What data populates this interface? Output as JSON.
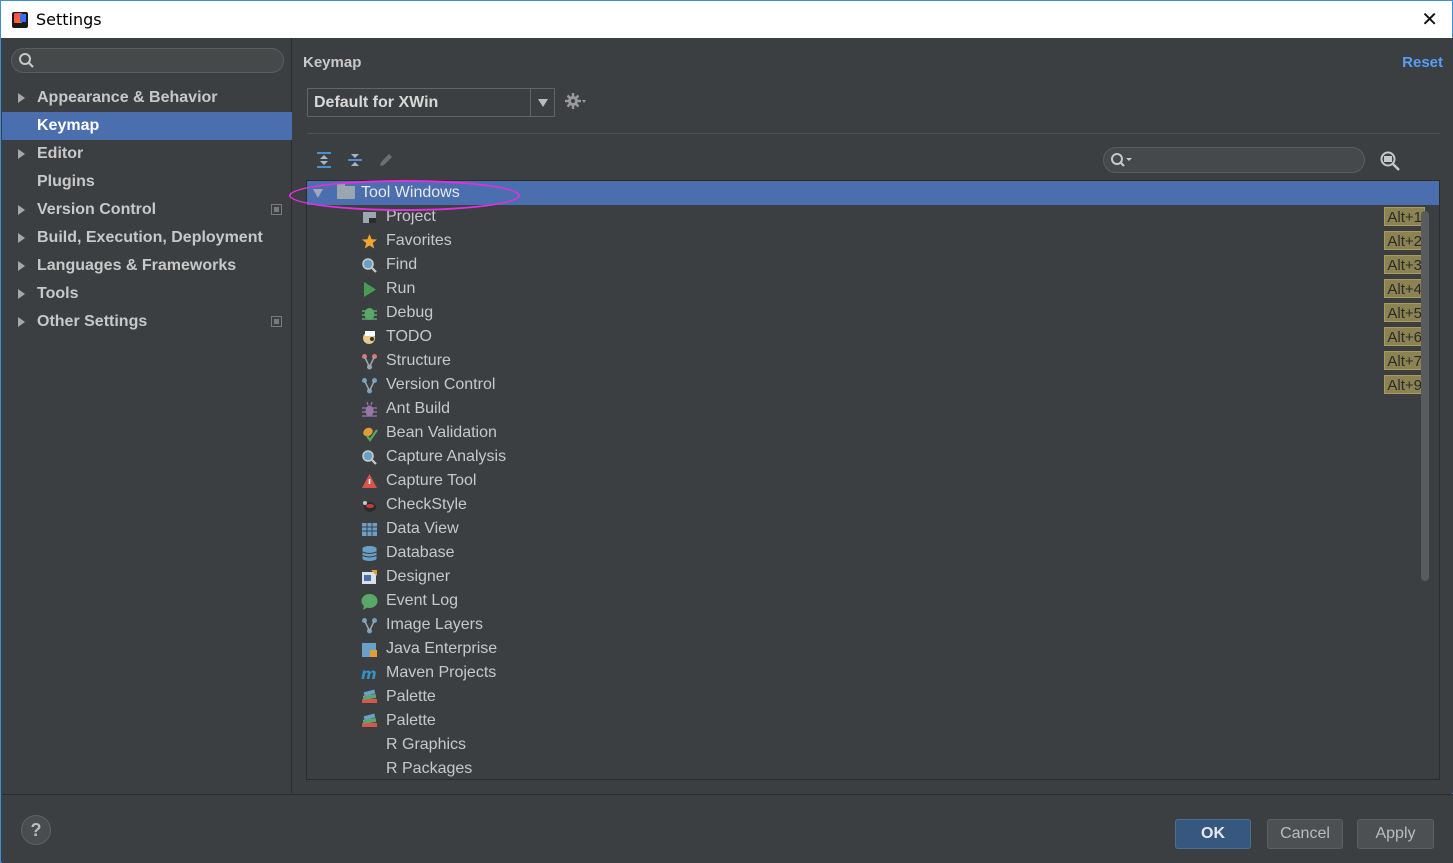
{
  "window": {
    "title": "Settings"
  },
  "sidebar": {
    "search_placeholder": "",
    "items": [
      {
        "label": "Appearance & Behavior",
        "expandable": true,
        "selected": false,
        "project": false
      },
      {
        "label": "Keymap",
        "expandable": false,
        "selected": true,
        "project": false
      },
      {
        "label": "Editor",
        "expandable": true,
        "selected": false,
        "project": false
      },
      {
        "label": "Plugins",
        "expandable": false,
        "selected": false,
        "project": false
      },
      {
        "label": "Version Control",
        "expandable": true,
        "selected": false,
        "project": true
      },
      {
        "label": "Build, Execution, Deployment",
        "expandable": true,
        "selected": false,
        "project": false
      },
      {
        "label": "Languages & Frameworks",
        "expandable": true,
        "selected": false,
        "project": false
      },
      {
        "label": "Tools",
        "expandable": true,
        "selected": false,
        "project": false
      },
      {
        "label": "Other Settings",
        "expandable": true,
        "selected": false,
        "project": true
      }
    ]
  },
  "main": {
    "title": "Keymap",
    "reset_label": "Reset",
    "keymap_selected": "Default for XWin",
    "filter_placeholder": ""
  },
  "tree": {
    "folder": {
      "label": "Tool Windows",
      "expanded": true,
      "selected": true
    },
    "rows": [
      {
        "label": "Project",
        "icon": "project-icon",
        "shortcut": "Alt+1"
      },
      {
        "label": "Favorites",
        "icon": "star-icon",
        "shortcut": "Alt+2"
      },
      {
        "label": "Find",
        "icon": "find-icon",
        "shortcut": "Alt+3"
      },
      {
        "label": "Run",
        "icon": "run-icon",
        "shortcut": "Alt+4"
      },
      {
        "label": "Debug",
        "icon": "debug-bug-icon",
        "shortcut": "Alt+5"
      },
      {
        "label": "TODO",
        "icon": "todo-icon",
        "shortcut": "Alt+6"
      },
      {
        "label": "Structure",
        "icon": "structure-icon",
        "shortcut": "Alt+7"
      },
      {
        "label": "Version Control",
        "icon": "vcs-branch-icon",
        "shortcut": "Alt+9"
      },
      {
        "label": "Ant Build",
        "icon": "ant-icon",
        "shortcut": ""
      },
      {
        "label": "Bean Validation",
        "icon": "bean-validation-icon",
        "shortcut": ""
      },
      {
        "label": "Capture Analysis",
        "icon": "capture-analysis-icon",
        "shortcut": ""
      },
      {
        "label": "Capture Tool",
        "icon": "capture-tool-icon",
        "shortcut": ""
      },
      {
        "label": "CheckStyle",
        "icon": "checkstyle-icon",
        "shortcut": ""
      },
      {
        "label": "Data View",
        "icon": "data-view-icon",
        "shortcut": ""
      },
      {
        "label": "Database",
        "icon": "database-icon",
        "shortcut": ""
      },
      {
        "label": "Designer",
        "icon": "designer-icon",
        "shortcut": ""
      },
      {
        "label": "Event Log",
        "icon": "event-log-icon",
        "shortcut": ""
      },
      {
        "label": "Image Layers",
        "icon": "image-layers-icon",
        "shortcut": ""
      },
      {
        "label": "Java Enterprise",
        "icon": "java-enterprise-icon",
        "shortcut": ""
      },
      {
        "label": "Maven Projects",
        "icon": "maven-icon",
        "shortcut": ""
      },
      {
        "label": "Palette",
        "icon": "palette-icon",
        "shortcut": ""
      },
      {
        "label": "Palette",
        "icon": "palette-icon",
        "shortcut": ""
      },
      {
        "label": "R Graphics",
        "icon": "",
        "shortcut": ""
      },
      {
        "label": "R Packages",
        "icon": "",
        "shortcut": ""
      }
    ]
  },
  "footer": {
    "help_label": "?",
    "ok_label": "OK",
    "cancel_label": "Cancel",
    "apply_label": "Apply"
  },
  "colors": {
    "background": "#3c3f41",
    "selection": "#4b6eaf",
    "link": "#589df6",
    "shortcut_badge": "#8c8352",
    "annotation_oval": "#e030e0"
  }
}
